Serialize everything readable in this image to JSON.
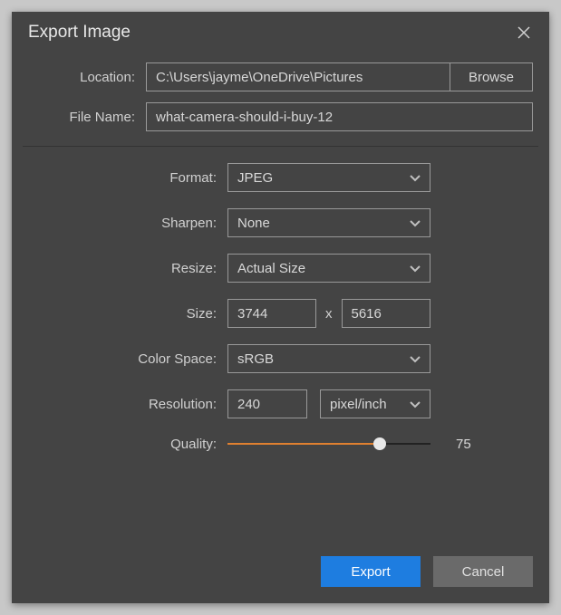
{
  "title": "Export Image",
  "location": {
    "label": "Location:",
    "value": "C:\\Users\\jayme\\OneDrive\\Pictures",
    "browse": "Browse"
  },
  "filename": {
    "label": "File Name:",
    "value": "what-camera-should-i-buy-12"
  },
  "format": {
    "label": "Format:",
    "value": "JPEG"
  },
  "sharpen": {
    "label": "Sharpen:",
    "value": "None"
  },
  "resize": {
    "label": "Resize:",
    "value": "Actual Size"
  },
  "size": {
    "label": "Size:",
    "width": "3744",
    "height": "5616",
    "sep": "x"
  },
  "colorspace": {
    "label": "Color Space:",
    "value": "sRGB"
  },
  "resolution": {
    "label": "Resolution:",
    "value": "240",
    "unit": "pixel/inch"
  },
  "quality": {
    "label": "Quality:",
    "value": "75"
  },
  "buttons": {
    "export": "Export",
    "cancel": "Cancel"
  }
}
